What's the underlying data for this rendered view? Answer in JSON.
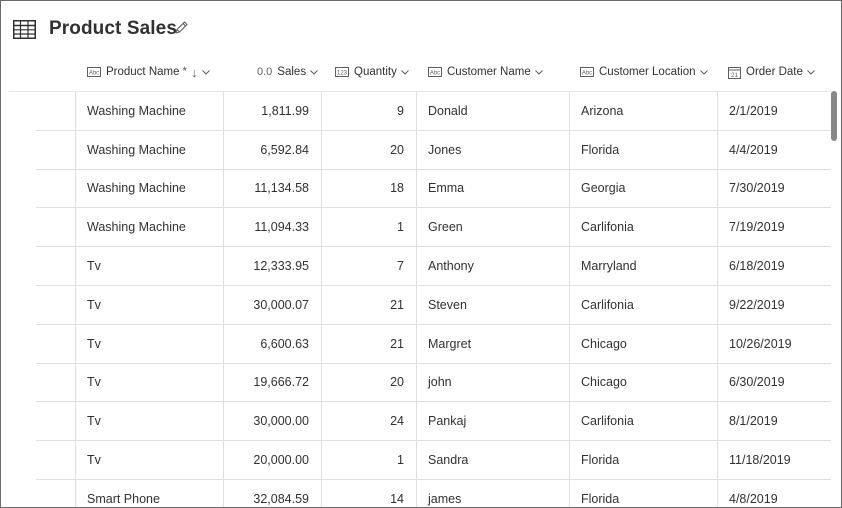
{
  "title": "Product Sales",
  "columns": {
    "product": {
      "label": "Product Name",
      "required": "*",
      "sort": "↓",
      "type_label": "Abc"
    },
    "sales": {
      "label": "Sales",
      "type_label": "0.0"
    },
    "quantity": {
      "label": "Quantity",
      "type_label": "123"
    },
    "customer": {
      "label": "Customer Name",
      "type_label": "Abc"
    },
    "location": {
      "label": "Customer Location",
      "type_label": "Abc"
    },
    "date": {
      "label": "Order Date",
      "type_label": "21"
    }
  },
  "rows": [
    {
      "product": "Washing Machine",
      "sales": "1,811.99",
      "quantity": "9",
      "customer": "Donald",
      "location": "Arizona",
      "date": "2/1/2019"
    },
    {
      "product": "Washing Machine",
      "sales": "6,592.84",
      "quantity": "20",
      "customer": "Jones",
      "location": "Florida",
      "date": "4/4/2019"
    },
    {
      "product": "Washing Machine",
      "sales": "11,134.58",
      "quantity": "18",
      "customer": "Emma",
      "location": "Georgia",
      "date": "7/30/2019"
    },
    {
      "product": "Washing Machine",
      "sales": "11,094.33",
      "quantity": "1",
      "customer": "Green",
      "location": "Carlifonia",
      "date": "7/19/2019"
    },
    {
      "product": "Tv",
      "sales": "12,333.95",
      "quantity": "7",
      "customer": "Anthony",
      "location": "Marryland",
      "date": "6/18/2019"
    },
    {
      "product": "Tv",
      "sales": "30,000.07",
      "quantity": "21",
      "customer": "Steven",
      "location": "Carlifonia",
      "date": "9/22/2019"
    },
    {
      "product": "Tv",
      "sales": "6,600.63",
      "quantity": "21",
      "customer": "Margret",
      "location": "Chicago",
      "date": "10/26/2019"
    },
    {
      "product": "Tv",
      "sales": "19,666.72",
      "quantity": "20",
      "customer": "john",
      "location": "Chicago",
      "date": "6/30/2019"
    },
    {
      "product": "Tv",
      "sales": "30,000.00",
      "quantity": "24",
      "customer": "Pankaj",
      "location": "Carlifonia",
      "date": "8/1/2019"
    },
    {
      "product": "Tv",
      "sales": "20,000.00",
      "quantity": "1",
      "customer": "Sandra",
      "location": "Florida",
      "date": "11/18/2019"
    },
    {
      "product": "Smart Phone",
      "sales": "32,084.59",
      "quantity": "14",
      "customer": "james",
      "location": "Florida",
      "date": "4/8/2019"
    }
  ]
}
